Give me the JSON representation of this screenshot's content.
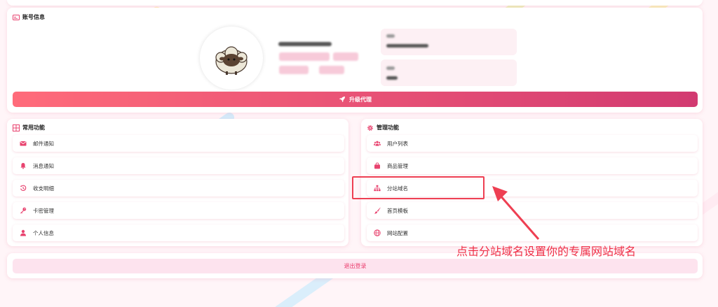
{
  "account": {
    "title": "账号信息",
    "upgrade_label": "升级代理"
  },
  "common": {
    "title": "常用功能",
    "items": [
      {
        "label": "邮件通知",
        "icon": "mail-icon"
      },
      {
        "label": "消息通知",
        "icon": "bell-icon"
      },
      {
        "label": "收支明细",
        "icon": "history-icon"
      },
      {
        "label": "卡密管理",
        "icon": "key-icon"
      },
      {
        "label": "个人信息",
        "icon": "user-icon"
      }
    ]
  },
  "manage": {
    "title": "管理功能",
    "items": [
      {
        "label": "用户列表",
        "icon": "users-icon"
      },
      {
        "label": "商品管理",
        "icon": "bag-icon"
      },
      {
        "label": "分站域名",
        "icon": "sitemap-icon"
      },
      {
        "label": "首页模板",
        "icon": "brush-icon"
      },
      {
        "label": "网站配置",
        "icon": "globe-icon"
      }
    ]
  },
  "logout_label": "退出登录",
  "annotation": "点击分站域名设置你的专属网站域名",
  "colors": {
    "accent": "#e8436f",
    "gradient_start": "#ff6b7a",
    "gradient_end": "#d23a71",
    "annotation_red": "#ef2f47"
  }
}
